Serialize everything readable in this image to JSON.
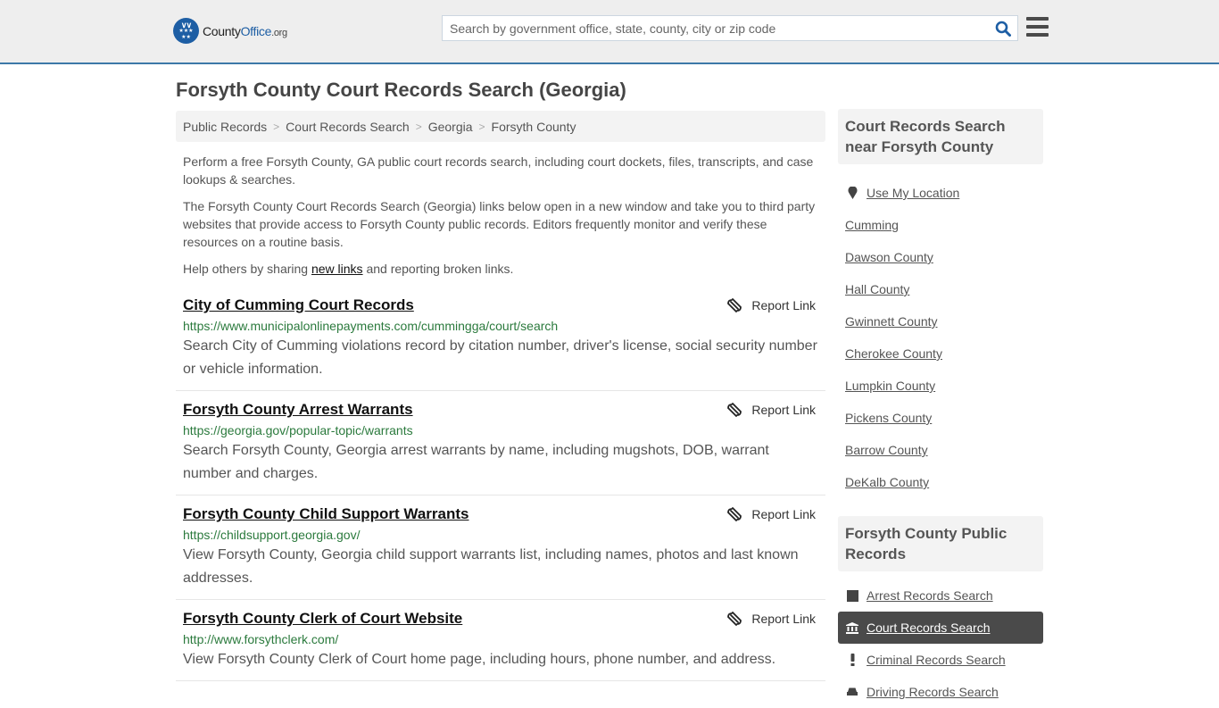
{
  "header": {
    "logo": {
      "name_part1": "County",
      "name_part2": "Office",
      "suffix": ".org"
    },
    "search": {
      "placeholder": "Search by government office, state, county, city or zip code",
      "value": ""
    },
    "accent_color": "#3d78a8",
    "brand_color": "#1d5ea4"
  },
  "page": {
    "title": "Forsyth County Court Records Search (Georgia)",
    "breadcrumb": [
      "Public Records",
      "Court Records Search",
      "Georgia",
      "Forsyth County"
    ],
    "intro": {
      "p1": "Perform a free Forsyth County, GA public court records search, including court dockets, files, transcripts, and case lookups & searches.",
      "p2": "The Forsyth County Court Records Search (Georgia) links below open in a new window and take you to third party websites that provide access to Forsyth County public records. Editors frequently monitor and verify these resources on a routine basis.",
      "p3_before": "Help others by sharing ",
      "p3_link": "new links",
      "p3_after": " and reporting broken links."
    },
    "report_label": "Report Link",
    "results": [
      {
        "title": "City of Cumming Court Records",
        "url": "https://www.municipalonlinepayments.com/cummingga/court/search",
        "description": "Search City of Cumming violations record by citation number, driver's license, social security number or vehicle information."
      },
      {
        "title": "Forsyth County Arrest Warrants",
        "url": "https://georgia.gov/popular-topic/warrants",
        "description": "Search Forsyth County, Georgia arrest warrants by name, including mugshots, DOB, warrant number and charges."
      },
      {
        "title": "Forsyth County Child Support Warrants",
        "url": "https://childsupport.georgia.gov/",
        "description": "View Forsyth County, Georgia child support warrants list, including names, photos and last known addresses."
      },
      {
        "title": "Forsyth County Clerk of Court Website",
        "url": "http://www.forsythclerk.com/",
        "description": "View Forsyth County Clerk of Court home page, including hours, phone number, and address."
      }
    ]
  },
  "sidebar": {
    "nearby": {
      "heading": "Court Records Search near Forsyth County",
      "use_location": "Use My Location",
      "items": [
        "Cumming",
        "Dawson County",
        "Hall County",
        "Gwinnett County",
        "Cherokee County",
        "Lumpkin County",
        "Pickens County",
        "Barrow County",
        "DeKalb County"
      ]
    },
    "public_records": {
      "heading": "Forsyth County Public Records",
      "items": [
        {
          "label": "Arrest Records Search",
          "icon": "square-icon",
          "active": false
        },
        {
          "label": "Court Records Search",
          "icon": "courthouse-icon",
          "active": true
        },
        {
          "label": "Criminal Records Search",
          "icon": "exclamation-icon",
          "active": false
        },
        {
          "label": "Driving Records Search",
          "icon": "car-icon",
          "active": false
        }
      ]
    }
  }
}
